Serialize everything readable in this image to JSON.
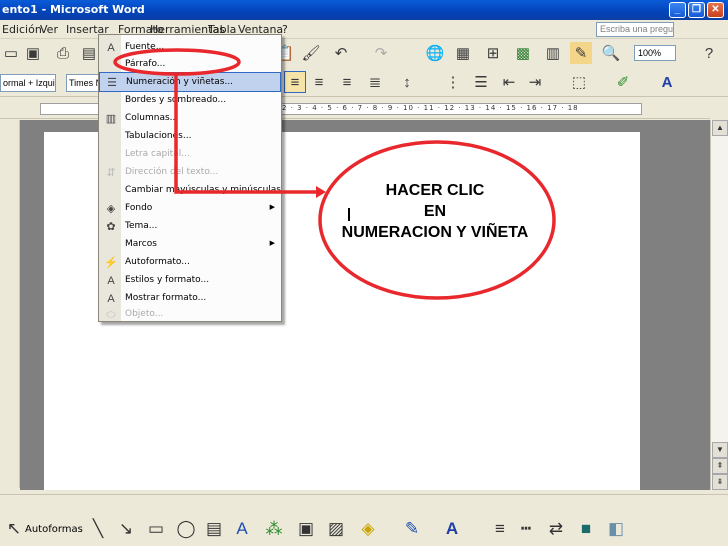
{
  "window": {
    "title": "ento1 - Microsoft Word",
    "buttons": {
      "minimize": "_",
      "restore": "❐",
      "close": "✕"
    }
  },
  "menubar": {
    "items": [
      "Edición",
      "Ver",
      "Insertar",
      "Formato",
      "Herramientas",
      "Tabla",
      "Ventana",
      "?"
    ],
    "help_placeholder": "Escriba una pregunta"
  },
  "toolbar": {
    "zoom": "100%",
    "style_combo": "ormal + Izquie",
    "font_combo": "Times New"
  },
  "ruler": {
    "numbers": "2 · 3 · 4 · 5 · 6 · 7 · 8 · 9 · 10 · 11 · 12 · 13 · 14 · 15 · 16 · 17 · 18"
  },
  "format_menu": {
    "items": [
      {
        "label": "Fuente...",
        "icon": "font-icon",
        "enabled": true,
        "submenu": false
      },
      {
        "label": "Párrafo...",
        "icon": "",
        "enabled": true,
        "submenu": false
      },
      {
        "label": "Numeración y viñetas...",
        "icon": "bullets-icon",
        "enabled": true,
        "submenu": false,
        "highlighted": true
      },
      {
        "label": "Bordes y sombreado...",
        "icon": "",
        "enabled": true,
        "submenu": false
      },
      {
        "label": "Columnas...",
        "icon": "columns-icon",
        "enabled": true,
        "submenu": false
      },
      {
        "label": "Tabulaciones...",
        "icon": "",
        "enabled": true,
        "submenu": false
      },
      {
        "label": "Letra capital...",
        "icon": "",
        "enabled": false,
        "submenu": false
      },
      {
        "label": "Dirección del texto...",
        "icon": "text-direction-icon",
        "enabled": false,
        "submenu": false
      },
      {
        "label": "Cambiar mayúsculas y minúsculas...",
        "icon": "",
        "enabled": true,
        "submenu": false
      },
      {
        "label": "Fondo",
        "icon": "background-icon",
        "enabled": true,
        "submenu": true
      },
      {
        "label": "Tema...",
        "icon": "theme-icon",
        "enabled": true,
        "submenu": false
      },
      {
        "label": "Marcos",
        "icon": "",
        "enabled": true,
        "submenu": true
      },
      {
        "label": "Autoformato...",
        "icon": "autoformat-icon",
        "enabled": true,
        "submenu": false
      },
      {
        "label": "Estilos y formato...",
        "icon": "styles-icon",
        "enabled": true,
        "submenu": false
      },
      {
        "label": "Mostrar formato...",
        "icon": "reveal-format-icon",
        "enabled": true,
        "submenu": false
      },
      {
        "label": "Objeto...",
        "icon": "object-icon",
        "enabled": false,
        "submenu": false
      }
    ]
  },
  "callout": {
    "line1": "HACER CLIC",
    "line2": "EN",
    "line3": "NUMERACION Y VIÑETA"
  },
  "drawing_toolbar": {
    "autoshapes_label": "Autoformas"
  },
  "annotation_colors": {
    "red": "#e8282d"
  }
}
